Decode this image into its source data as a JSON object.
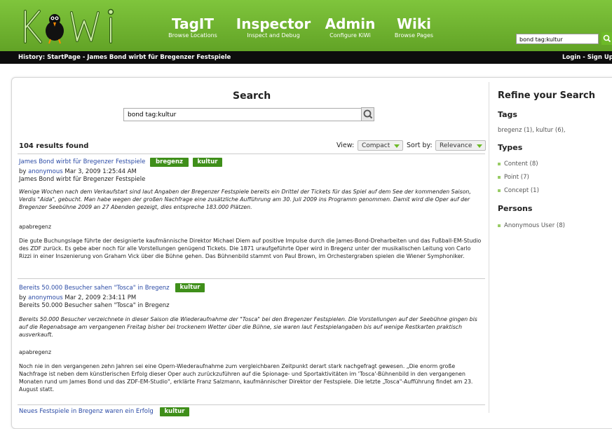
{
  "brand": {
    "logo_text": "KiWi",
    "accent": "#6dba28",
    "dark": "#0d0d0d"
  },
  "nav": [
    {
      "title": "TagIT",
      "sub": "Browse Locations"
    },
    {
      "title": "Inspector",
      "sub": "Inspect and Debug"
    },
    {
      "title": "Admin",
      "sub": "Configure KiWi"
    },
    {
      "title": "Wiki",
      "sub": "Browse Pages"
    }
  ],
  "top_search": {
    "value": "bond tag:kultur",
    "icon": "search-icon"
  },
  "history": {
    "prefix": "History:",
    "path": "StartPage - James Bond wirbt für Bregenzer Festspiele",
    "right": "Login - Sign Up"
  },
  "search": {
    "title": "Search",
    "query": "bond tag:kultur",
    "icon": "search-icon",
    "results_found": "104 results found",
    "view_label": "View:",
    "view_value": "Compact",
    "sort_label": "Sort by:",
    "sort_value": "Relevance"
  },
  "results": [
    {
      "title": "James Bond wirbt für Bregenzer Festspiele",
      "tags": [
        "bregenz",
        "kultur"
      ],
      "by": "by",
      "author": "anonymous",
      "date": "Mar 3, 2009 1:25:44 AM",
      "subtitle": "James Bond wirbt für Bregenzer Festspiele",
      "lead": "Wenige Wochen nach dem Verkaufstart sind laut Angaben der Bregenzer Festspiele bereits ein Drittel der Tickets für das Spiel auf dem See der kommenden Saison, Verdis \"Aida\", gebucht. Man habe wegen der großen Nachfrage eine zusätzliche Aufführung am 30. Juli 2009 ins Programm genommen. Damit wird die Oper auf der Bregenzer Seebühne 2009 an 27 Abenden gezeigt, dies entspreche 183.000 Plätzen.",
      "source": "apabregenz",
      "text": "Die gute Buchungslage führte der designierte kaufmännische Direktor Michael Diem auf positive Impulse durch die James-Bond-Dreharbeiten und das Fußball-EM-Studio des ZDF zurück. Es gebe aber noch für alle Vorstellungen genügend Tickets. Die 1871 uraufgeführte Oper wird in Bregenz unter der musikalischen Leitung von Carlo Rizzi in einer Inszenierung von Graham Vick über die Bühne gehen. Das Bühnenbild stammt von Paul Brown, im Orchestergraben spielen die Wiener Symphoniker."
    },
    {
      "title": "Bereits 50.000 Besucher sahen \"Tosca\" in Bregenz",
      "tags": [
        "kultur"
      ],
      "by": "by",
      "author": "anonymous",
      "date": "Mar 2, 2009 2:34:11 PM",
      "subtitle": "Bereits 50.000 Besucher sahen \"Tosca\" in Bregenz",
      "lead": "Bereits 50.000 Besucher verzeichnete in dieser Saison die Wiederaufnahme der \"Tosca\" bei den Bregenzer Festspielen. Die Vorstellungen auf der Seebühne gingen bis auf die Regenabsage am vergangenen Freitag bisher bei trockenem Wetter über die Bühne, sie waren laut Festspielangaben bis auf wenige Restkarten praktisch ausverkauft.",
      "source": "apabregenz",
      "text": "Noch nie in den vergangenen zehn Jahren sei eine Opern-Wiederaufnahme zum vergleichbaren Zeitpunkt derart stark nachgefragt gewesen. „Die enorm große Nachfrage ist neben dem künstlerischen Erfolg dieser Oper auch zurückzuführen auf die Spionage- und Sportaktivitäten im 'Tosca'-Bühnenbild in den vergangenen Monaten rund um James Bond und das ZDF-EM-Studio\", erklärte Franz Salzmann, kaufmännischer Direktor der Festspiele. Die letzte „Tosca\"-Aufführung findet am 23. August statt."
    },
    {
      "title": "Neues Festspiele in Bregenz waren ein Erfolg",
      "tags": [
        "kultur"
      ]
    }
  ],
  "refine": {
    "title": "Refine your Search",
    "tags_heading": "Tags",
    "tags_text": "bregenz (1), kultur (6),",
    "types_heading": "Types",
    "types": [
      "Content (8)",
      "Point (7)",
      "Concept (1)"
    ],
    "persons_heading": "Persons",
    "persons": [
      "Anonymous User (8)"
    ]
  }
}
